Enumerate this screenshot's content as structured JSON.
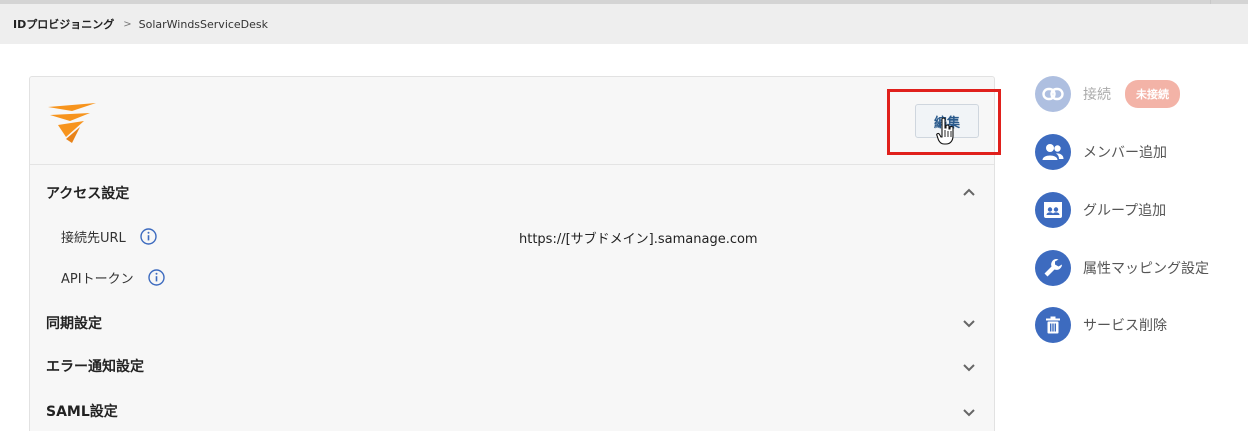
{
  "breadcrumb": {
    "root": "IDプロビジョニング",
    "separator": ">",
    "current": "SolarWindsServiceDesk"
  },
  "header": {
    "edit_label": "編集"
  },
  "sections": {
    "access": {
      "title": "アクセス設定",
      "fields": [
        {
          "label": "接続先URL",
          "value": "https://[サブドメイン].samanage.com"
        },
        {
          "label": "APIトークン",
          "value": ""
        }
      ]
    },
    "sync": {
      "title": "同期設定"
    },
    "error": {
      "title": "エラー通知設定"
    },
    "saml": {
      "title": "SAML設定"
    }
  },
  "sidebar": {
    "connect": {
      "label": "接続",
      "badge": "未接続",
      "icon": "link-icon"
    },
    "items": [
      {
        "label": "メンバー追加",
        "icon": "users-icon"
      },
      {
        "label": "グループ追加",
        "icon": "group-card-icon"
      },
      {
        "label": "属性マッピング設定",
        "icon": "wrench-icon"
      },
      {
        "label": "サービス削除",
        "icon": "trash-icon"
      }
    ]
  },
  "colors": {
    "accent": "#3d6bbf",
    "accent_disabled": "#aebfe0",
    "badge": "#f3b3a7",
    "highlight": "#e0201c",
    "logo": "#f7941d"
  }
}
